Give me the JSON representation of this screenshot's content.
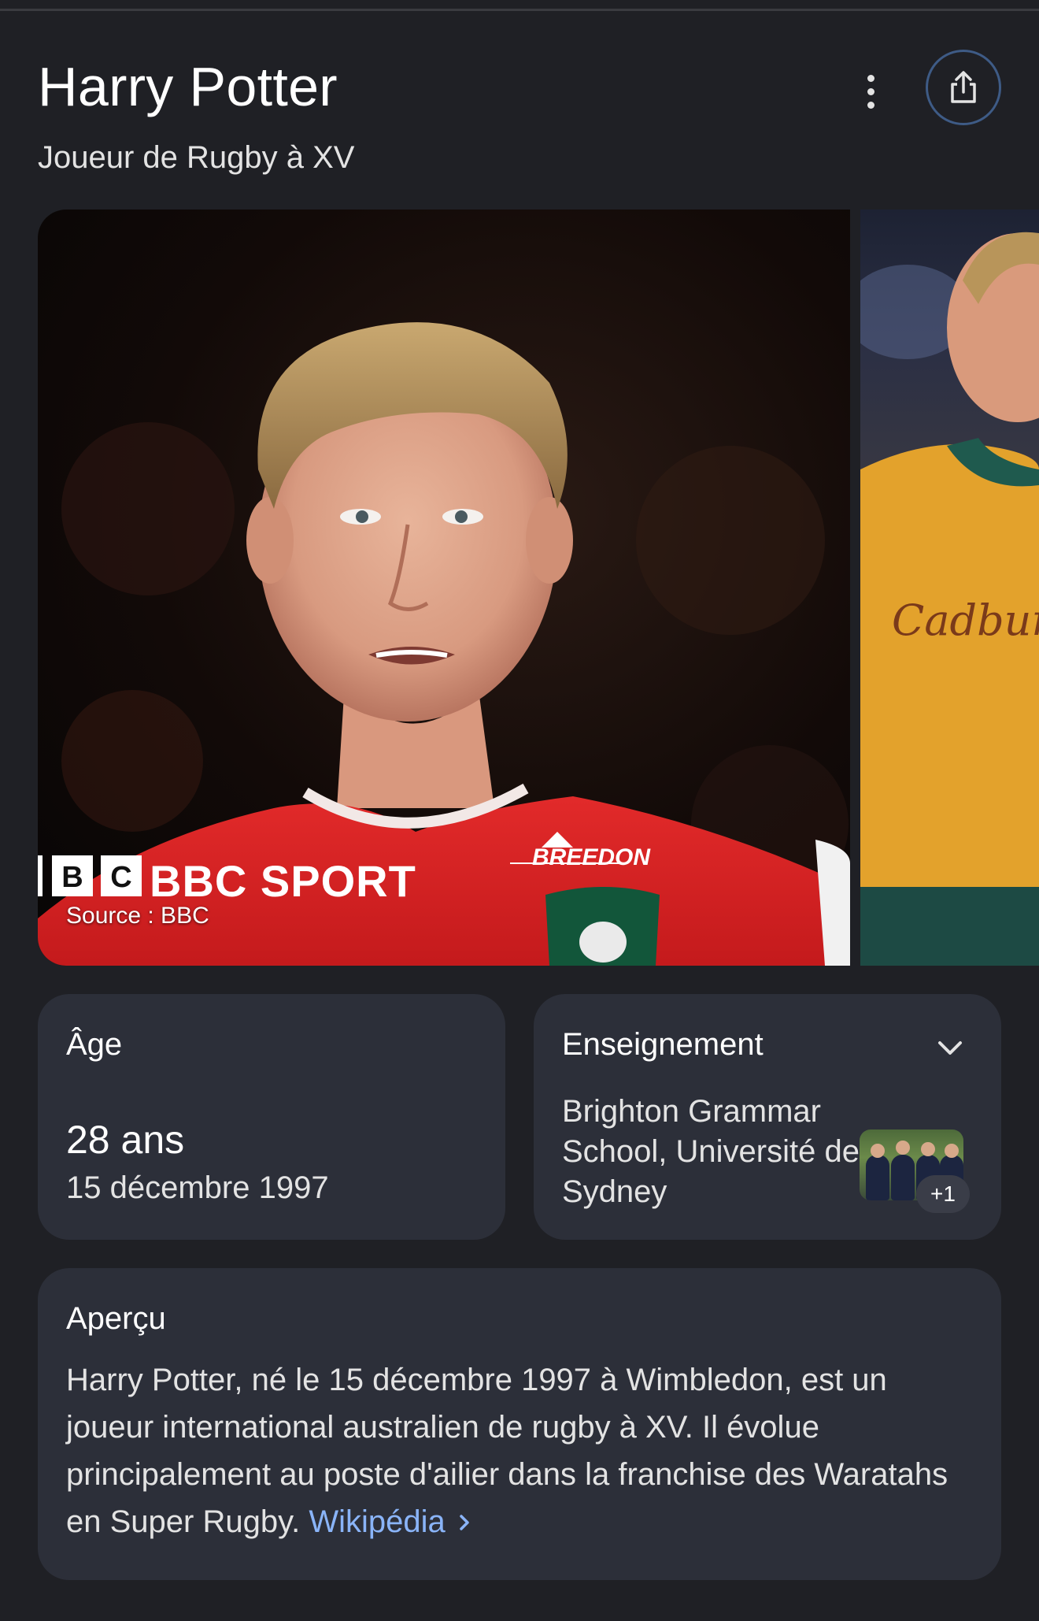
{
  "header": {
    "title": "Harry Potter",
    "subtitle": "Joueur de Rugby à XV"
  },
  "carousel": {
    "image1": {
      "overlay_brand": "BBC SPORT",
      "jersey_sponsor": "BREEDON",
      "source": "Source : BBC"
    },
    "image2": {
      "jersey_sponsor": "Cadbury"
    }
  },
  "age_card": {
    "label": "Âge",
    "value": "28 ans",
    "date": "15 décembre 1997"
  },
  "education_card": {
    "label": "Enseignement",
    "value": "Brighton Grammar School, Université de Sydney",
    "more_count": "+1"
  },
  "overview_card": {
    "label": "Aperçu",
    "text": "Harry Potter, né le 15 décembre 1997 à Wimbledon, est un joueur international australien de rugby à XV. Il évolue principalement au poste d'ailier dans la franchise des Waratahs en Super Rugby.",
    "link_label": "Wikipédia"
  },
  "colors": {
    "background": "#1f2025",
    "card": "#2c2f39",
    "link": "#8ab4f8",
    "share_ring": "#3e5b86"
  },
  "icons": {
    "menu": "more-vert-icon",
    "share": "share-icon",
    "expand": "chevron-down-icon",
    "link": "chevron-right-icon"
  }
}
